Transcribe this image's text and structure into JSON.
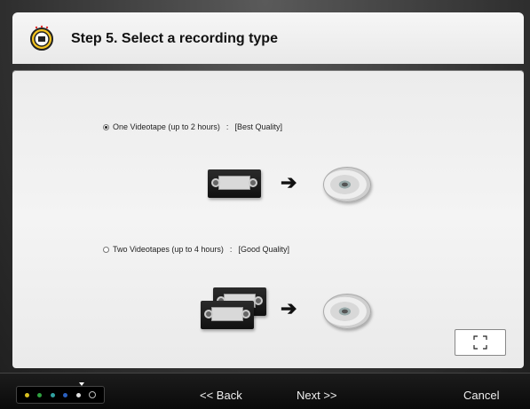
{
  "header": {
    "title": "Step 5. Select a recording type",
    "icon": "wizard-badge-icon"
  },
  "options": [
    {
      "label": "One Videotape (up to 2 hours)",
      "separator": ":",
      "quality": "[Best Quality]",
      "selected": true
    },
    {
      "label": "Two Videotapes (up to 4 hours)",
      "separator": ":",
      "quality": "[Good Quality]",
      "selected": false
    }
  ],
  "footer": {
    "back_label": "<< Back",
    "next_label": "Next >>",
    "cancel_label": "Cancel",
    "progress_dot_colors": [
      "#d8c020",
      "#2fa040",
      "#30a0a0",
      "#2a60c0",
      "#e0e0e0"
    ]
  }
}
